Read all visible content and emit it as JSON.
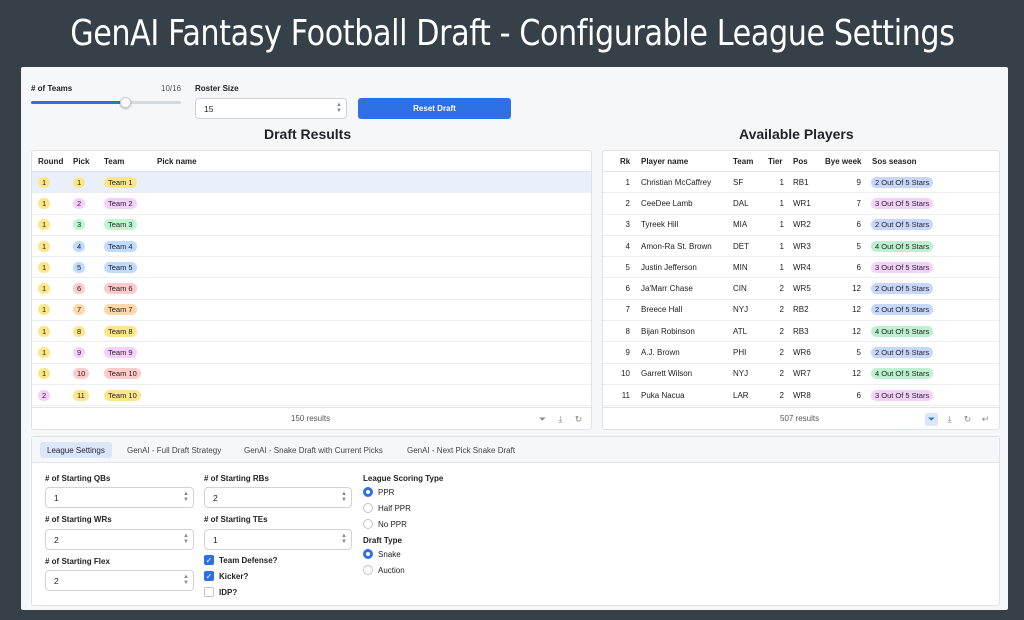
{
  "banner": {
    "title": "GenAI Fantasy Football Draft - Configurable League Settings"
  },
  "controls": {
    "teams_label": "# of Teams",
    "teams_value": "10/16",
    "teams_fraction": 0.625,
    "roster_label": "Roster Size",
    "roster_value": "15",
    "reset_label": "Reset Draft"
  },
  "draft": {
    "title": "Draft Results",
    "columns": [
      "Round",
      "Pick",
      "Team",
      "Pick name"
    ],
    "rows": [
      {
        "round": "1",
        "pick": "1",
        "team": "Team 1"
      },
      {
        "round": "1",
        "pick": "2",
        "team": "Team 2"
      },
      {
        "round": "1",
        "pick": "3",
        "team": "Team 3"
      },
      {
        "round": "1",
        "pick": "4",
        "team": "Team 4"
      },
      {
        "round": "1",
        "pick": "5",
        "team": "Team 5"
      },
      {
        "round": "1",
        "pick": "6",
        "team": "Team 6"
      },
      {
        "round": "1",
        "pick": "7",
        "team": "Team 7"
      },
      {
        "round": "1",
        "pick": "8",
        "team": "Team 8"
      },
      {
        "round": "1",
        "pick": "9",
        "team": "Team 9"
      },
      {
        "round": "1",
        "pick": "10",
        "team": "Team 10"
      },
      {
        "round": "2",
        "pick": "11",
        "team": "Team 10"
      }
    ],
    "results": "150 results"
  },
  "players": {
    "title": "Available Players",
    "columns": [
      "Rk",
      "Player name",
      "Team",
      "Tier",
      "Pos",
      "Bye week",
      "Sos season"
    ],
    "rows": [
      {
        "rk": "1",
        "name": "Christian McCaffrey",
        "team": "SF",
        "tier": "1",
        "pos": "RB1",
        "bye": "9",
        "sos": "2 Out Of 5 Stars"
      },
      {
        "rk": "2",
        "name": "CeeDee Lamb",
        "team": "DAL",
        "tier": "1",
        "pos": "WR1",
        "bye": "7",
        "sos": "3 Out Of 5 Stars"
      },
      {
        "rk": "3",
        "name": "Tyreek Hill",
        "team": "MIA",
        "tier": "1",
        "pos": "WR2",
        "bye": "6",
        "sos": "2 Out Of 5 Stars"
      },
      {
        "rk": "4",
        "name": "Amon-Ra St. Brown",
        "team": "DET",
        "tier": "1",
        "pos": "WR3",
        "bye": "5",
        "sos": "4 Out Of 5 Stars"
      },
      {
        "rk": "5",
        "name": "Justin Jefferson",
        "team": "MIN",
        "tier": "1",
        "pos": "WR4",
        "bye": "6",
        "sos": "3 Out Of 5 Stars"
      },
      {
        "rk": "6",
        "name": "Ja'Marr Chase",
        "team": "CIN",
        "tier": "2",
        "pos": "WR5",
        "bye": "12",
        "sos": "2 Out Of 5 Stars"
      },
      {
        "rk": "7",
        "name": "Breece Hall",
        "team": "NYJ",
        "tier": "2",
        "pos": "RB2",
        "bye": "12",
        "sos": "2 Out Of 5 Stars"
      },
      {
        "rk": "8",
        "name": "Bijan Robinson",
        "team": "ATL",
        "tier": "2",
        "pos": "RB3",
        "bye": "12",
        "sos": "4 Out Of 5 Stars"
      },
      {
        "rk": "9",
        "name": "A.J. Brown",
        "team": "PHI",
        "tier": "2",
        "pos": "WR6",
        "bye": "5",
        "sos": "2 Out Of 5 Stars"
      },
      {
        "rk": "10",
        "name": "Garrett Wilson",
        "team": "NYJ",
        "tier": "2",
        "pos": "WR7",
        "bye": "12",
        "sos": "4 Out Of 5 Stars"
      },
      {
        "rk": "11",
        "name": "Puka Nacua",
        "team": "LAR",
        "tier": "2",
        "pos": "WR8",
        "bye": "6",
        "sos": "3 Out Of 5 Stars"
      }
    ],
    "results": "507 results"
  },
  "tabs": [
    "League Settings",
    "GenAI - Full Draft Strategy",
    "GenAI - Snake Draft with Current Picks",
    "GenAI - Next Pick Snake Draft"
  ],
  "settings": {
    "qbs_label": "# of Starting QBs",
    "qbs_value": "1",
    "wrs_label": "# of Starting WRs",
    "wrs_value": "2",
    "flex_label": "# of Starting Flex",
    "flex_value": "2",
    "rbs_label": "# of Starting RBs",
    "rbs_value": "2",
    "tes_label": "# of Starting TEs",
    "tes_value": "1",
    "defense_label": "Team Defense?",
    "defense_checked": true,
    "kicker_label": "Kicker?",
    "kicker_checked": true,
    "idp_label": "IDP?",
    "idp_checked": false,
    "scoring_label": "League Scoring Type",
    "scoring_options": [
      "PPR",
      "Half PPR",
      "No PPR"
    ],
    "scoring_selected": "PPR",
    "draft_type_label": "Draft Type",
    "draft_type_options": [
      "Snake",
      "Auction"
    ],
    "draft_type_selected": "Snake"
  },
  "colors": {
    "accent": "#2f6fe4",
    "team_pills": [
      "#fde68a",
      "#f5d0fe",
      "#bbf7d0",
      "#bfdbfe",
      "#bfdbfe",
      "#fecaca",
      "#fed7aa",
      "#fde68a",
      "#f5d0fe",
      "#fecaca"
    ],
    "sos_pills": {
      "2 Out Of 5 Stars": "#c7d7fb",
      "3 Out Of 5 Stars": "#f3d1fb",
      "4 Out Of 5 Stars": "#bdf0cf"
    }
  }
}
